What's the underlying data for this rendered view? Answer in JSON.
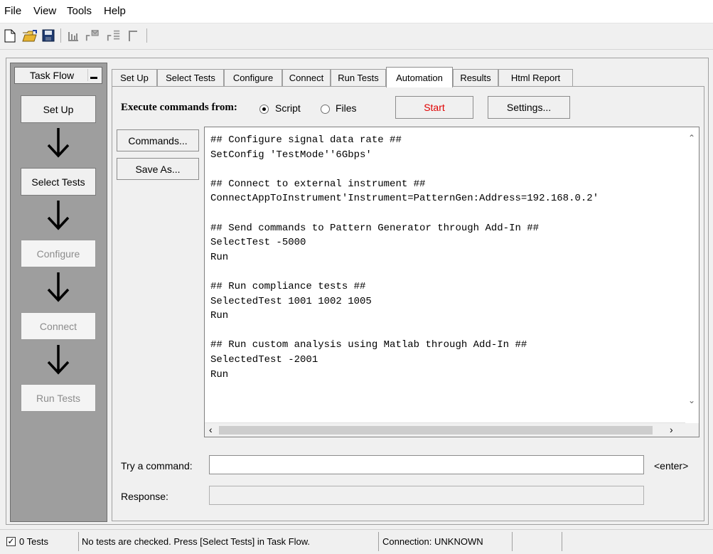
{
  "menu": [
    "File",
    "View",
    "Tools",
    "Help"
  ],
  "toolbar": {
    "icons": [
      "new-file-icon",
      "open-folder-icon",
      "save-icon",
      "chart-icon",
      "send-icon",
      "list-icon",
      "marker-icon"
    ]
  },
  "task_flow": {
    "title": "Task Flow",
    "steps": [
      {
        "label": "Set Up",
        "enabled": true
      },
      {
        "label": "Select Tests",
        "enabled": true
      },
      {
        "label": "Configure",
        "enabled": false
      },
      {
        "label": "Connect",
        "enabled": false
      },
      {
        "label": "Run Tests",
        "enabled": false
      }
    ]
  },
  "tabs": [
    "Set Up",
    "Select Tests",
    "Configure",
    "Connect",
    "Run Tests",
    "Automation",
    "Results",
    "Html Report"
  ],
  "active_tab": "Automation",
  "execute": {
    "label": "Execute commands from:",
    "options": [
      "Script",
      "Files"
    ],
    "selected": "Script",
    "start_label": "Start",
    "settings_label": "Settings..."
  },
  "side_buttons": {
    "commands": "Commands...",
    "save_as": "Save As..."
  },
  "script_lines": [
    "## Configure signal data rate ##",
    "SetConfig 'TestMode''6Gbps'",
    "",
    "## Connect to external instrument ##",
    "ConnectAppToInstrument'Instrument=PatternGen:Address=192.168.0.2'",
    "",
    "## Send commands to Pattern Generator through Add-In ##",
    "SelectTest -5000",
    "Run",
    "",
    "## Run compliance tests ##",
    "SelectedTest 1001 1002 1005",
    "Run",
    "",
    "## Run custom analysis using Matlab through Add-In ##",
    "SelectedTest -2001",
    "Run"
  ],
  "command": {
    "label": "Try a command:",
    "value": "",
    "enter_label": "<enter>"
  },
  "response": {
    "label": "Response:",
    "value": ""
  },
  "status": {
    "tests_count": "0 Tests",
    "message": "No tests are checked. Press [Select Tests] in Task Flow.",
    "connection": "Connection: UNKNOWN"
  },
  "colors": {
    "start_text": "#e00000",
    "task_flow_bg": "#9e9e9e"
  }
}
